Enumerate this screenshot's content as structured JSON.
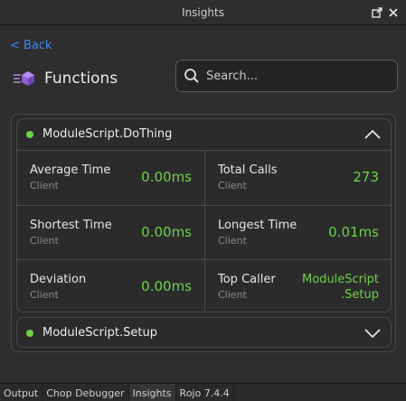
{
  "window": {
    "title": "Insights"
  },
  "nav": {
    "back_label": "< Back"
  },
  "header": {
    "title": "Functions",
    "icon": "functions-icon"
  },
  "search": {
    "placeholder": "Search..."
  },
  "colors": {
    "accent_link": "#3d8bf2",
    "value_green": "#6fd14a",
    "status_dot": "#6fd14a"
  },
  "functions": [
    {
      "name": "ModuleScript.DoThing",
      "expanded": true,
      "stats": [
        {
          "label": "Average Time",
          "sub": "Client",
          "value": "0.00ms"
        },
        {
          "label": "Total Calls",
          "sub": "Client",
          "value": "273"
        },
        {
          "label": "Shortest Time",
          "sub": "Client",
          "value": "0.00ms"
        },
        {
          "label": "Longest Time",
          "sub": "Client",
          "value": "0.01ms"
        },
        {
          "label": "Deviation",
          "sub": "Client",
          "value": "0.00ms"
        },
        {
          "label": "Top Caller",
          "sub": "Client",
          "value_line1": "ModuleScript",
          "value_line2": ".Setup"
        }
      ]
    },
    {
      "name": "ModuleScript.Setup",
      "expanded": false
    }
  ],
  "tabs": [
    "Output",
    "Chop Debugger",
    "Insights",
    "Rojo 7.4.4"
  ]
}
